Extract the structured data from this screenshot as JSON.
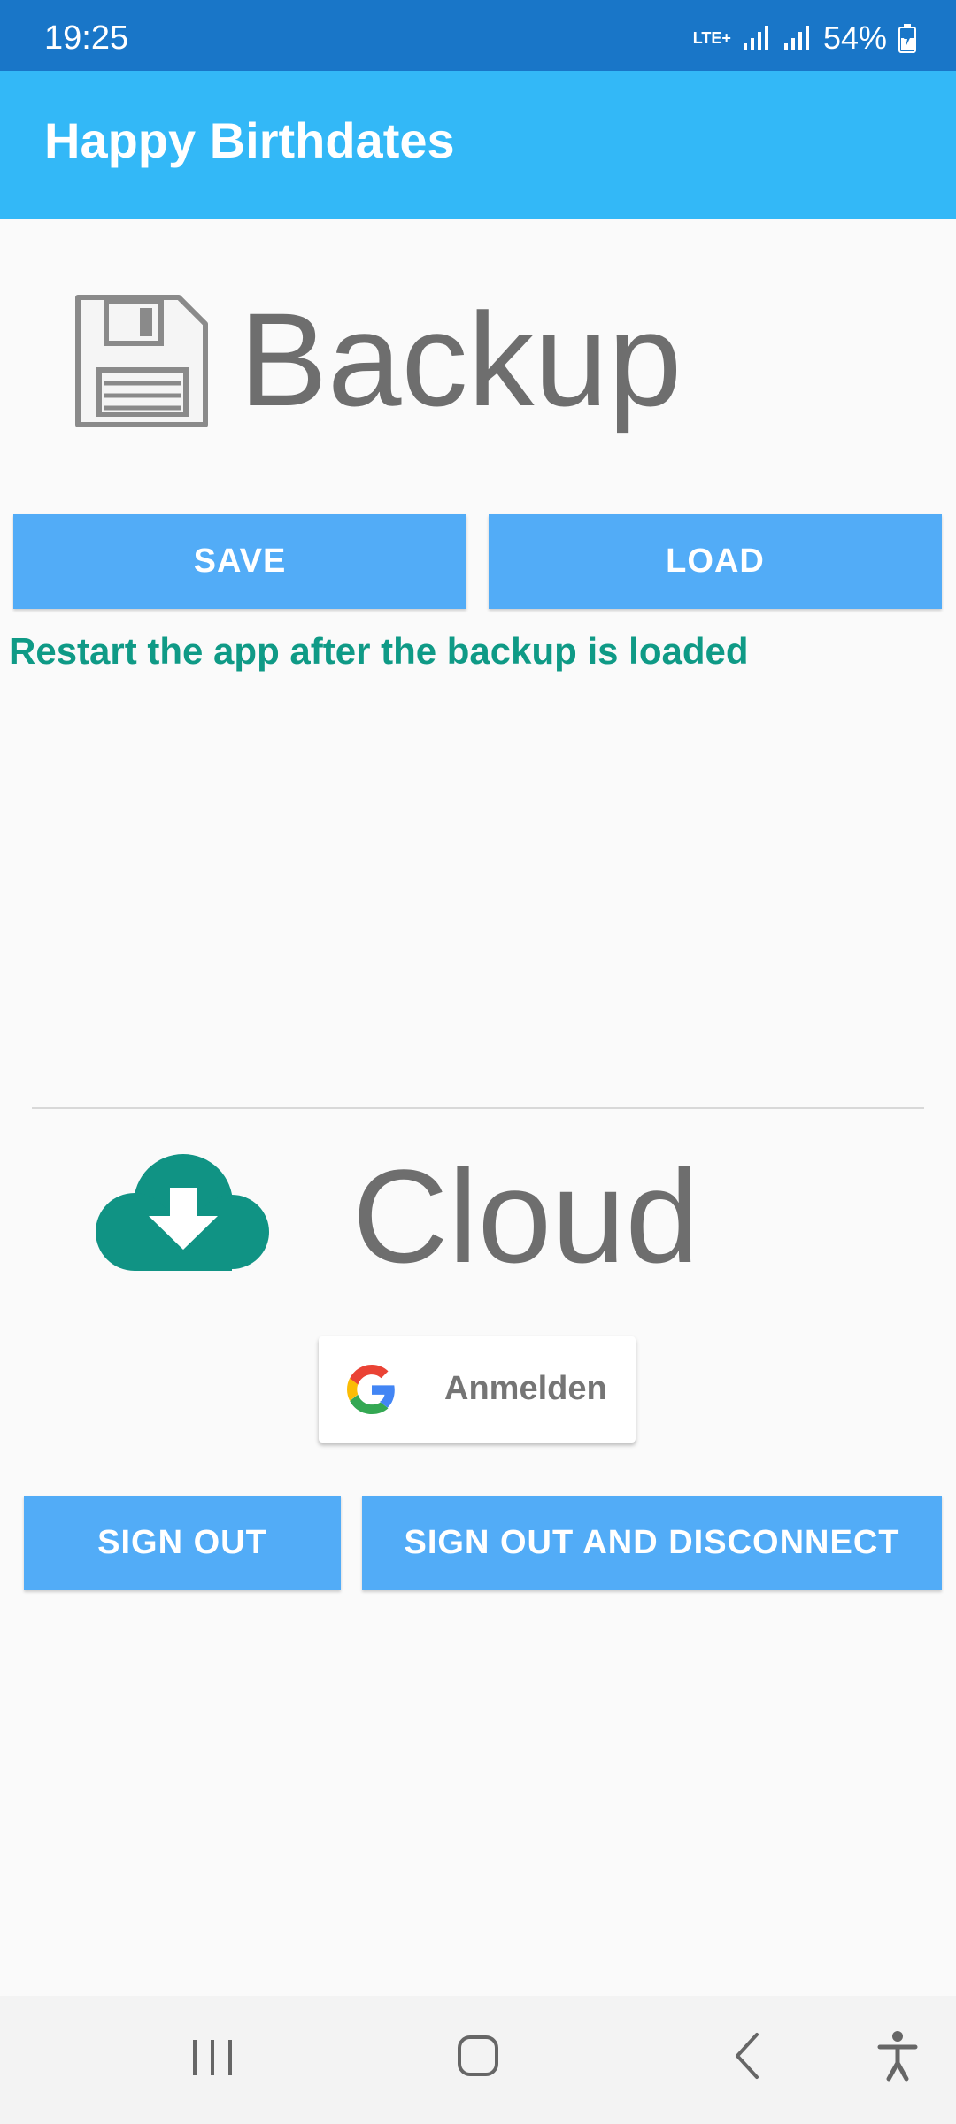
{
  "status": {
    "time": "19:25",
    "network": "LTE+",
    "battery": "54%"
  },
  "appbar": {
    "title": "Happy Birthdates"
  },
  "backup": {
    "title": "Backup",
    "save_label": "SAVE",
    "load_label": "LOAD",
    "hint": "Restart the app after the backup is loaded"
  },
  "cloud": {
    "title": "Cloud",
    "google_signin_label": "Anmelden",
    "sign_out_label": "SIGN OUT",
    "sign_out_disconnect_label": "SIGN OUT AND DISCONNECT"
  },
  "colors": {
    "status_bar": "#1976c8",
    "app_bar": "#33b8f7",
    "button": "#52acf7",
    "hint_text": "#0f9a86",
    "cloud_icon": "#109384"
  },
  "icons": {
    "backup": "floppy-disk-icon",
    "cloud": "cloud-download-icon",
    "google": "google-g-icon"
  }
}
